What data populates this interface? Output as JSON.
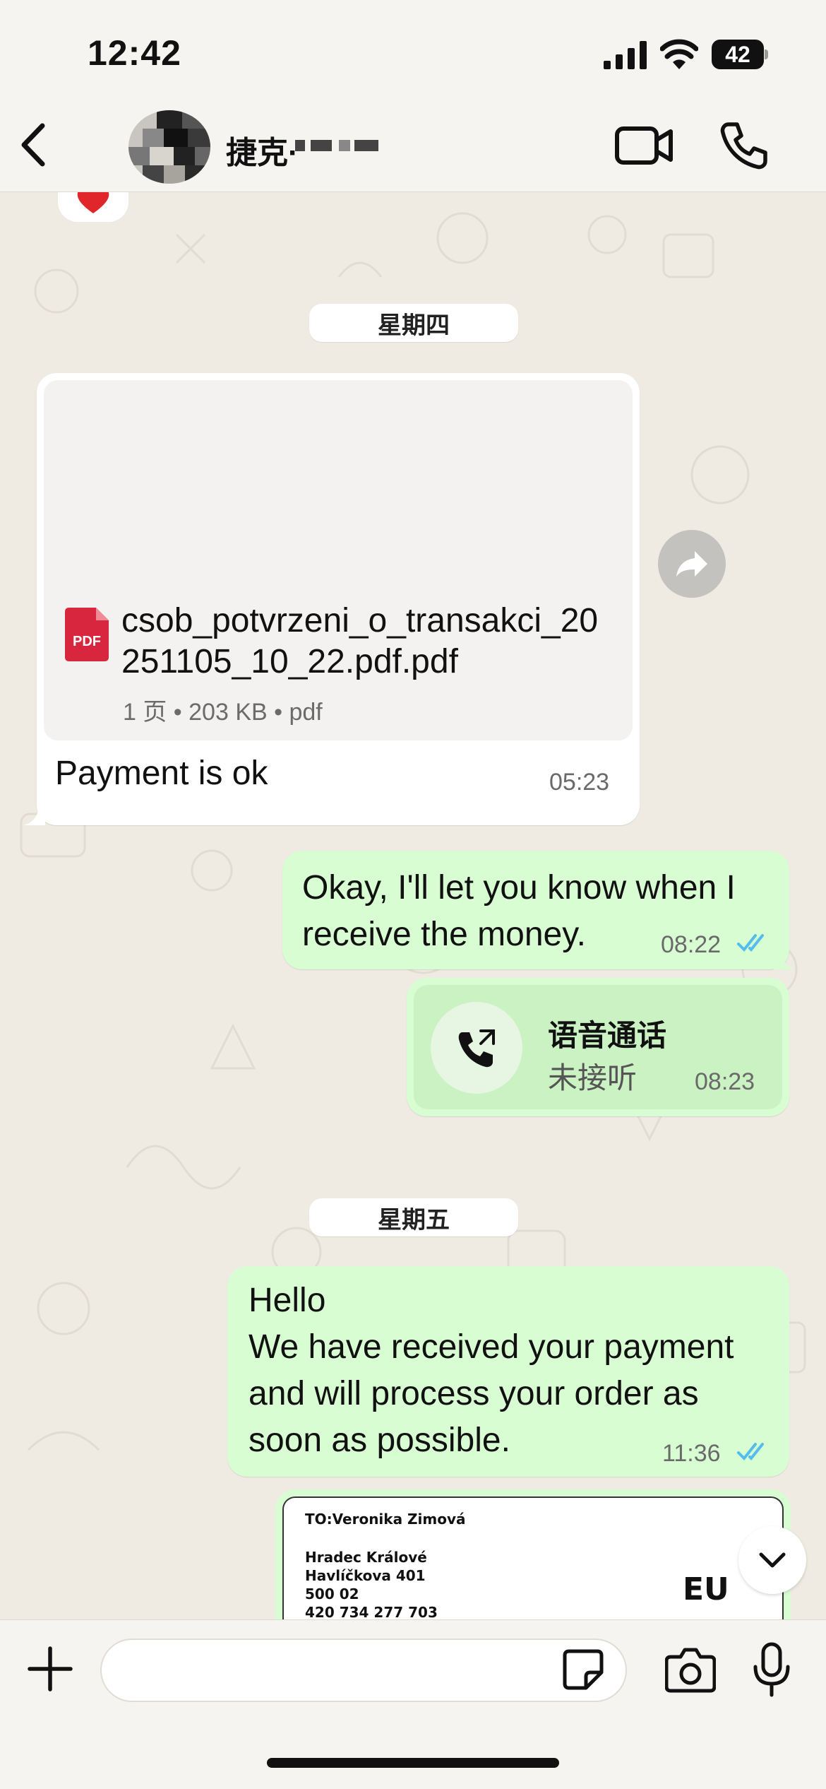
{
  "status_bar": {
    "time": "12:42",
    "battery": "42"
  },
  "header": {
    "contact_name": "捷克·",
    "icons": [
      "back-icon",
      "video-call-icon",
      "phone-icon"
    ]
  },
  "chat": {
    "date_dividers": [
      "星期四",
      "星期五"
    ],
    "messages": [
      {
        "type": "document",
        "direction": "incoming",
        "file_name": "csob_potvrzeni_o_transakci_20251105_10_22.pdf.pdf",
        "file_meta": "1 页 • 203 KB • pdf",
        "caption": "Payment is ok",
        "time": "05:23"
      },
      {
        "type": "text",
        "direction": "outgoing",
        "text": "Okay, I'll let you know when I receive the money.",
        "time": "08:22",
        "status": "read"
      },
      {
        "type": "call",
        "direction": "outgoing",
        "title": "语音通话",
        "status_text": "未接听",
        "time": "08:23"
      },
      {
        "type": "text",
        "direction": "outgoing",
        "line1": "Hello",
        "line2": "We have received your payment and will process your order as soon as possible.",
        "time": "11:36",
        "status": "read"
      },
      {
        "type": "image",
        "direction": "outgoing",
        "label_lines": [
          "TO:Veronika Zimová",
          "Hradec Králové",
          "Havlíčkova 401",
          "500 02",
          "420 734 277 703"
        ],
        "label_badge": "EU"
      }
    ]
  },
  "input": {
    "placeholder": ""
  },
  "colors": {
    "outgoing_bubble": "#d9fdd3",
    "incoming_bubble": "#ffffff",
    "read_ticks": "#53bdeb",
    "pdf_red": "#d7263d"
  }
}
